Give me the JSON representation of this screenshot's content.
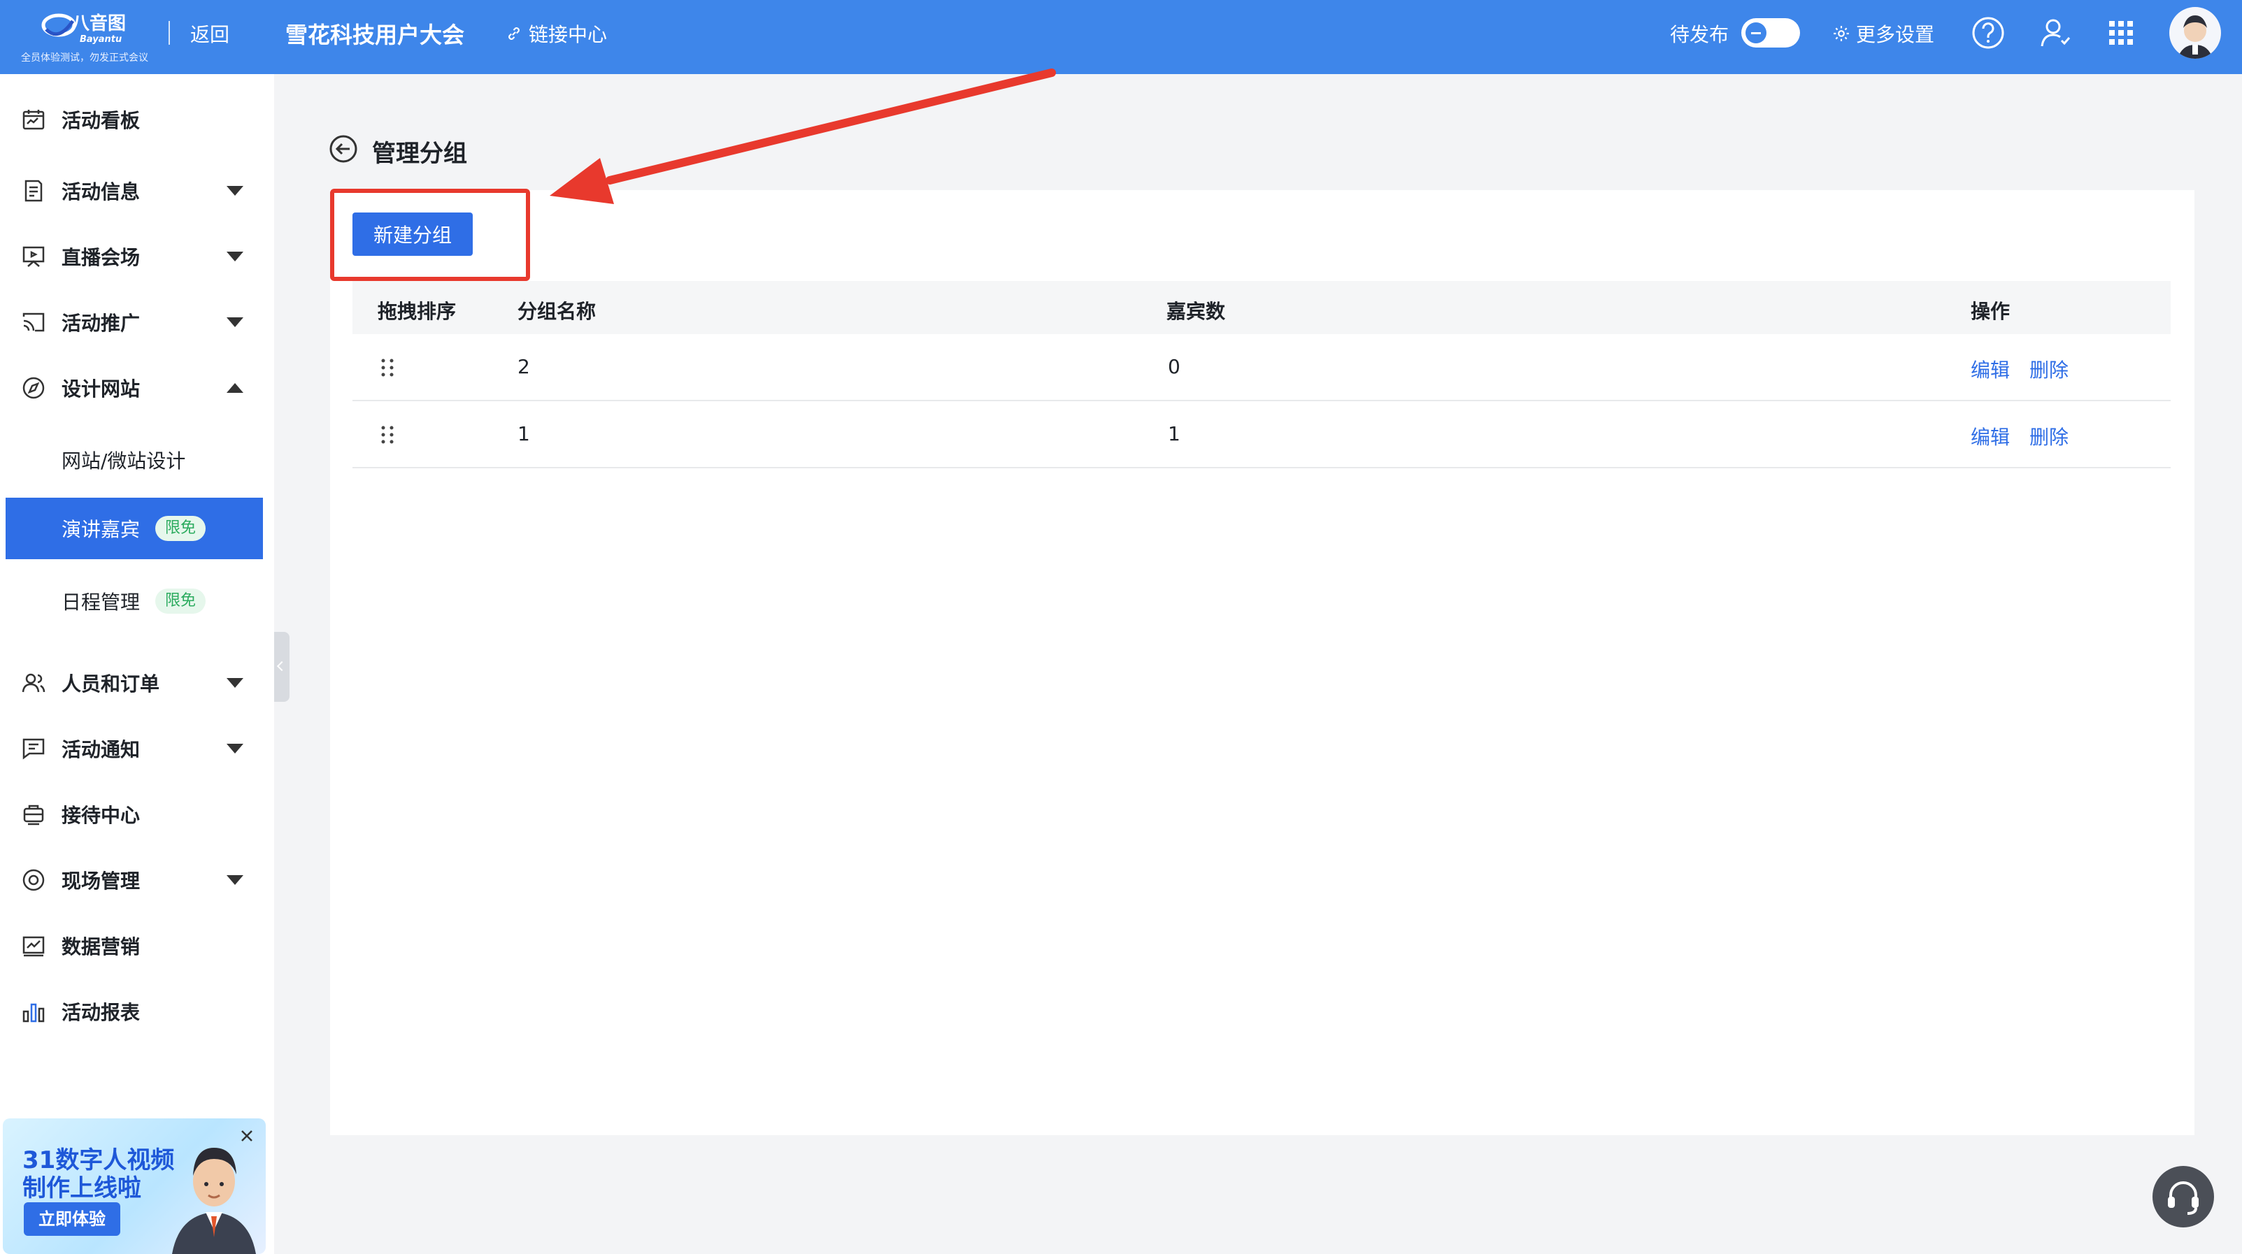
{
  "header": {
    "logo_text": "八音图",
    "logo_sub": "Bayantu",
    "logo_tagline": "全员体验测试，勿发正式会议",
    "back_label": "返回",
    "event_title": "雪花科技用户大会",
    "link_center_label": "链接中心",
    "status_label": "待发布",
    "more_settings_label": "更多设置",
    "icons": [
      "link-icon",
      "toggle-switch",
      "gear-icon",
      "help-icon",
      "user-icon",
      "apps-grid-icon",
      "avatar"
    ]
  },
  "sidebar": {
    "items": [
      {
        "label": "活动看板",
        "icon": "calendar-board-icon",
        "expandable": false
      },
      {
        "label": "活动信息",
        "icon": "document-icon",
        "expandable": true
      },
      {
        "label": "直播会场",
        "icon": "live-screen-icon",
        "expandable": true
      },
      {
        "label": "活动推广",
        "icon": "cast-icon",
        "expandable": true
      },
      {
        "label": "设计网站",
        "icon": "compass-icon",
        "expandable": true,
        "expanded": true
      },
      {
        "label": "人员和订单",
        "icon": "people-icon",
        "expandable": true
      },
      {
        "label": "活动通知",
        "icon": "message-icon",
        "expandable": true
      },
      {
        "label": "接待中心",
        "icon": "reception-icon",
        "expandable": false
      },
      {
        "label": "现场管理",
        "icon": "target-icon",
        "expandable": true
      },
      {
        "label": "数据营销",
        "icon": "chart-line-icon",
        "expandable": false
      },
      {
        "label": "活动报表",
        "icon": "bar-chart-icon",
        "expandable": false
      }
    ],
    "sub_items": [
      {
        "label": "网站/微站设计",
        "badge": "",
        "active": false
      },
      {
        "label": "演讲嘉宾",
        "badge": "限免",
        "active": true
      },
      {
        "label": "日程管理",
        "badge": "限免",
        "active": false
      }
    ]
  },
  "promo": {
    "line1": "31数字人视频",
    "line2": "制作上线啦",
    "cta": "立即体验"
  },
  "main": {
    "page_title": "管理分组",
    "new_group_button": "新建分组",
    "table": {
      "headers": [
        "拖拽排序",
        "分组名称",
        "嘉宾数",
        "操作"
      ],
      "rows": [
        {
          "name": "2",
          "count": "0",
          "edit": "编辑",
          "delete": "删除"
        },
        {
          "name": "1",
          "count": "1",
          "edit": "编辑",
          "delete": "删除"
        }
      ]
    }
  },
  "colors": {
    "header_bg": "#3e86ea",
    "primary": "#2f6ee6",
    "highlight": "#e8392d",
    "badge_bg": "#e6f7ec",
    "badge_text": "#2bab5e"
  }
}
